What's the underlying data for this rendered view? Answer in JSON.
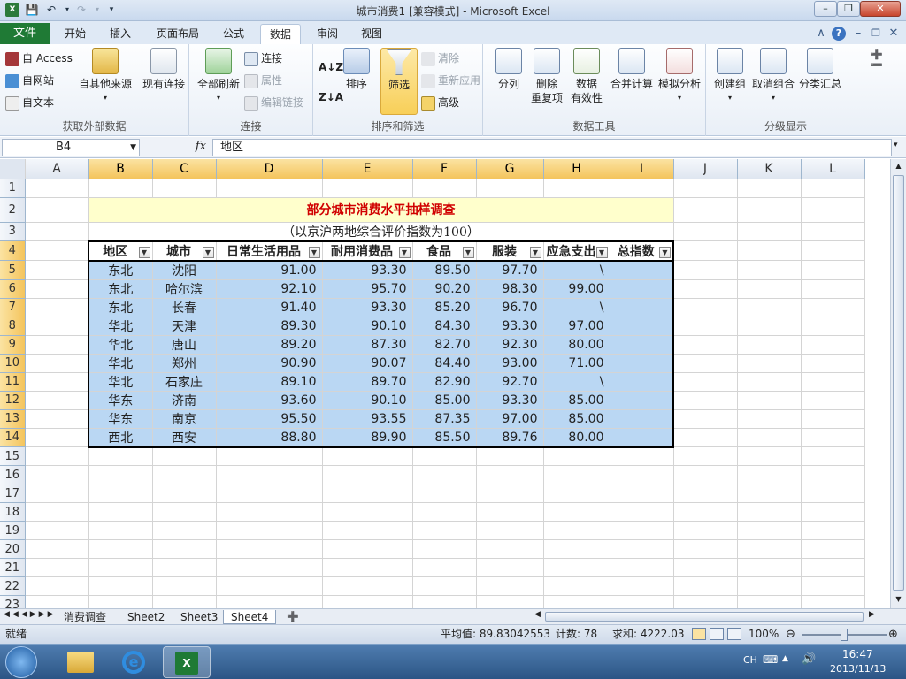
{
  "window": {
    "title": "城市消费1 [兼容模式] - Microsoft Excel"
  },
  "ribbon_tabs": [
    "文件",
    "开始",
    "插入",
    "页面布局",
    "公式",
    "数据",
    "审阅",
    "视图"
  ],
  "active_tab": "数据",
  "ribbon": {
    "get_external": {
      "access": "自 Access",
      "web": "自网站",
      "text": "自文本",
      "other": "自其他来源",
      "existing": "现有连接",
      "label": "获取外部数据"
    },
    "connections": {
      "refresh_all": "全部刷新",
      "connections": "连接",
      "properties": "属性",
      "edit_links": "编辑链接",
      "label": "连接"
    },
    "sort_filter": {
      "sort": "排序",
      "filter": "筛选",
      "clear": "清除",
      "reapply": "重新应用",
      "advanced": "高级",
      "label": "排序和筛选"
    },
    "data_tools": {
      "text_to_columns": "分列",
      "remove_dup_1": "删除",
      "remove_dup_2": "重复项",
      "validation_1": "数据",
      "validation_2": "有效性",
      "consolidate": "合并计算",
      "what_if": "模拟分析",
      "label": "数据工具"
    },
    "outline": {
      "group": "创建组",
      "ungroup": "取消组合",
      "subtotal": "分类汇总",
      "label": "分级显示"
    }
  },
  "formula_bar": {
    "name_box": "B4",
    "fx": "fx",
    "content": "地区"
  },
  "columns": [
    "A",
    "B",
    "C",
    "D",
    "E",
    "F",
    "G",
    "H",
    "I",
    "J",
    "K",
    "L"
  ],
  "rows": [
    "1",
    "2",
    "3",
    "4",
    "5",
    "6",
    "7",
    "8",
    "9",
    "10",
    "11",
    "12",
    "13",
    "14",
    "15",
    "16",
    "17",
    "18",
    "19",
    "20",
    "21",
    "22",
    "23"
  ],
  "sheet": {
    "title": "部分城市消费水平抽样调查",
    "subtitle": "（以京沪两地综合评价指数为100）",
    "headers": [
      "地区",
      "城市",
      "日常生活用品",
      "耐用消费品",
      "食品",
      "服装",
      "应急支出",
      "总指数"
    ],
    "data": [
      [
        "东北",
        "沈阳",
        "91.00",
        "93.30",
        "89.50",
        "97.70",
        "\\",
        ""
      ],
      [
        "东北",
        "哈尔滨",
        "92.10",
        "95.70",
        "90.20",
        "98.30",
        "99.00",
        ""
      ],
      [
        "东北",
        "长春",
        "91.40",
        "93.30",
        "85.20",
        "96.70",
        "\\",
        ""
      ],
      [
        "华北",
        "天津",
        "89.30",
        "90.10",
        "84.30",
        "93.30",
        "97.00",
        ""
      ],
      [
        "华北",
        "唐山",
        "89.20",
        "87.30",
        "82.70",
        "92.30",
        "80.00",
        ""
      ],
      [
        "华北",
        "郑州",
        "90.90",
        "90.07",
        "84.40",
        "93.00",
        "71.00",
        ""
      ],
      [
        "华北",
        "石家庄",
        "89.10",
        "89.70",
        "82.90",
        "92.70",
        "\\",
        ""
      ],
      [
        "华东",
        "济南",
        "93.60",
        "90.10",
        "85.00",
        "93.30",
        "85.00",
        ""
      ],
      [
        "华东",
        "南京",
        "95.50",
        "93.55",
        "87.35",
        "97.00",
        "85.00",
        ""
      ],
      [
        "西北",
        "西安",
        "88.80",
        "89.90",
        "85.50",
        "89.76",
        "80.00",
        ""
      ]
    ]
  },
  "sheet_tabs": [
    "消费调查",
    "Sheet2",
    "Sheet3",
    "Sheet4"
  ],
  "active_sheet": "Sheet4",
  "status": {
    "ready": "就绪",
    "average": "平均值: 89.83042553",
    "count": "计数: 78",
    "sum": "求和: 4222.03",
    "zoom": "100%"
  },
  "taskbar": {
    "lang": "CH",
    "time": "16:47",
    "date": "2013/11/13"
  }
}
